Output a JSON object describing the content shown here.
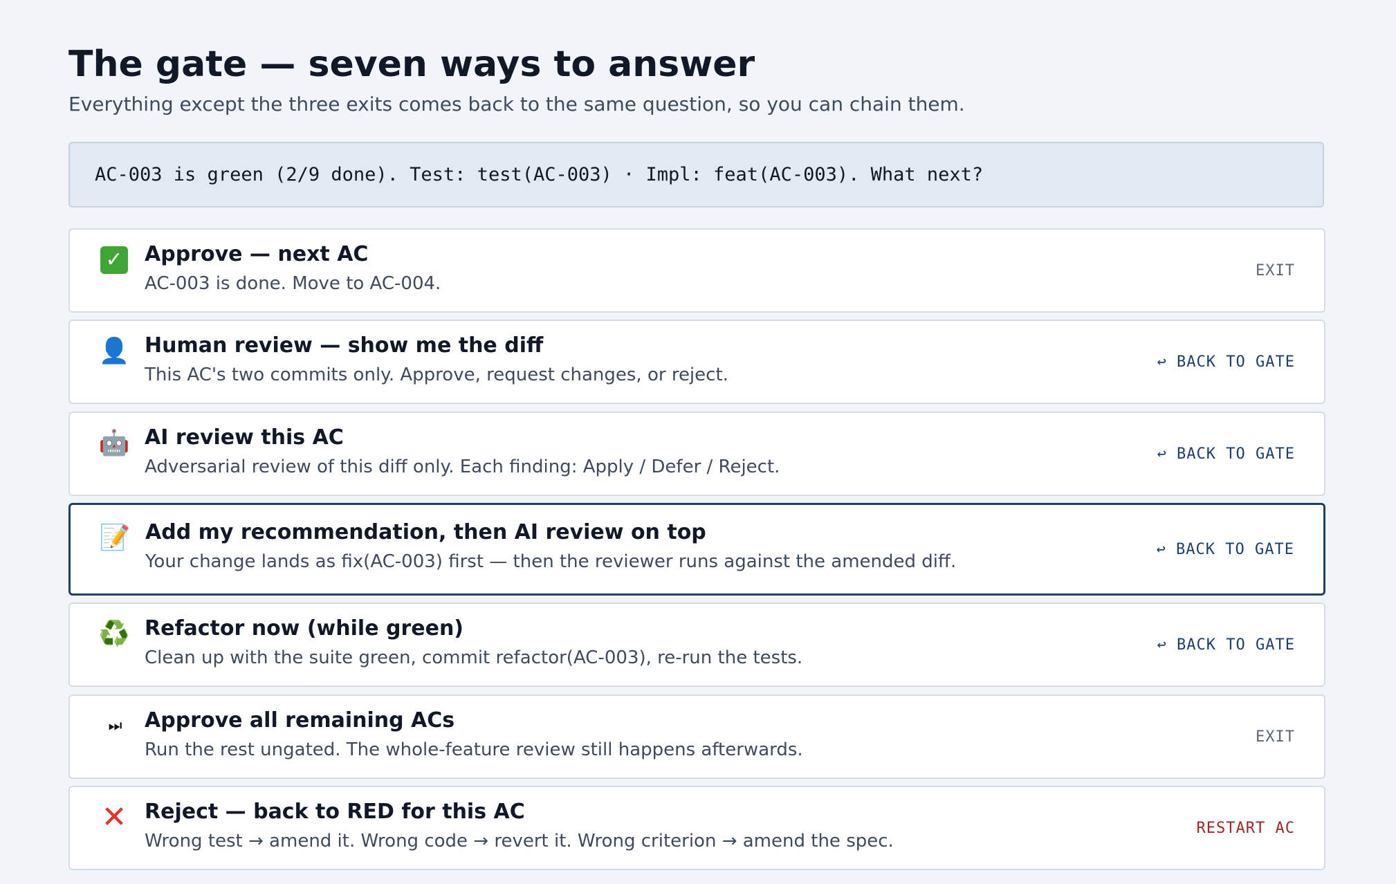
{
  "header": {
    "title": "The gate — seven ways to answer",
    "subtitle": "Everything except the three exits comes back to the same question, so you can chain them."
  },
  "prompt": {
    "text": "AC-003 is green (2/9 done). Test: test(AC-003) · Impl: feat(AC-003). What next?"
  },
  "options": [
    {
      "icon": "check-mark-icon",
      "icon_glyph": "✓",
      "title": "Approve — next AC",
      "description": "AC-003 is done. Move to AC-004.",
      "tag": "EXIT",
      "tag_kind": "exit",
      "selected": false
    },
    {
      "icon": "person-icon",
      "icon_glyph": "👤",
      "title": "Human review — show me the diff",
      "description": "This AC's two commits only. Approve, request changes, or reject.",
      "tag": "↩ BACK TO GATE",
      "tag_kind": "back",
      "selected": false
    },
    {
      "icon": "robot-icon",
      "icon_glyph": "🤖",
      "title": "AI review this AC",
      "description": "Adversarial review of this diff only. Each finding: Apply / Defer / Reject.",
      "tag": "↩ BACK TO GATE",
      "tag_kind": "back",
      "selected": false
    },
    {
      "icon": "memo-icon",
      "icon_glyph": "📝",
      "title": "Add my recommendation, then AI review on top",
      "description": "Your change lands as fix(AC-003) first — then the reviewer runs against the amended diff.",
      "tag": "↩ BACK TO GATE",
      "tag_kind": "back",
      "selected": true
    },
    {
      "icon": "recycle-icon",
      "icon_glyph": "♻️",
      "title": "Refactor now (while green)",
      "description": "Clean up with the suite green, commit refactor(AC-003), re-run the tests.",
      "tag": "↩ BACK TO GATE",
      "tag_kind": "back",
      "selected": false
    },
    {
      "icon": "fast-forward-icon",
      "icon_glyph": "⏭",
      "title": "Approve all remaining ACs",
      "description": "Run the rest ungated. The whole-feature review still happens afterwards.",
      "tag": "EXIT",
      "tag_kind": "exit",
      "selected": false
    },
    {
      "icon": "cross-mark-icon",
      "icon_glyph": "✕",
      "title": "Reject — back to RED for this AC",
      "description": "Wrong test → amend it. Wrong code → revert it. Wrong criterion → amend the spec.",
      "tag": "RESTART AC",
      "tag_kind": "restart",
      "selected": false
    }
  ],
  "colors": {
    "background": "#f1f4f8",
    "selected_border": "#1f3f6b",
    "restart": "#a12727",
    "exit": "#5b6675"
  }
}
